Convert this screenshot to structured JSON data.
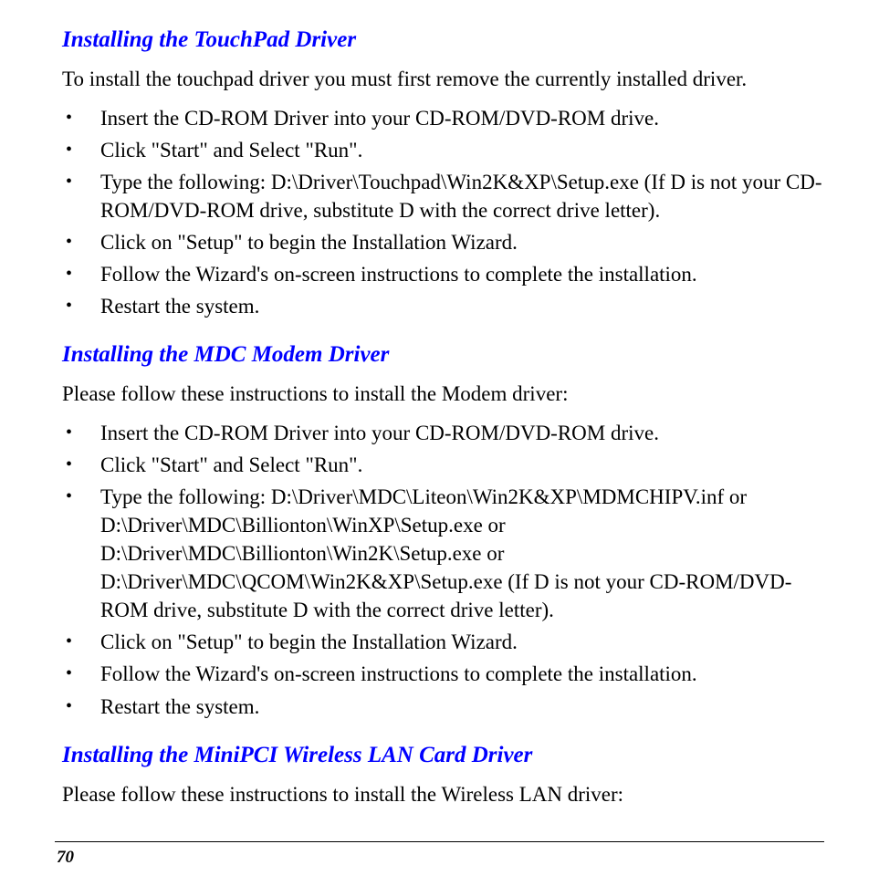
{
  "sections": [
    {
      "heading": "Installing the TouchPad Driver",
      "intro": "To install the touchpad driver you must first remove the currently installed driver.",
      "items": [
        "Insert the CD-ROM Driver into your CD-ROM/DVD-ROM drive.",
        "Click \"Start\" and Select \"Run\".",
        "Type the following: D:\\Driver\\Touchpad\\Win2K&XP\\Setup.exe (If D is not your CD-ROM/DVD-ROM drive, substitute D with the correct drive letter).",
        "Click on \"Setup\" to begin the Installation Wizard.",
        "Follow the Wizard's on-screen instructions to complete the installation.",
        "Restart the system."
      ]
    },
    {
      "heading": "Installing the MDC Modem Driver",
      "intro": "Please follow these instructions to install the Modem driver:",
      "items": [
        "Insert the CD-ROM Driver into your CD-ROM/DVD-ROM drive.",
        "Click \"Start\" and Select \"Run\".",
        "Type the following: D:\\Driver\\MDC\\Liteon\\Win2K&XP\\MDMCHIPV.inf or D:\\Driver\\MDC\\Billionton\\WinXP\\Setup.exe or D:\\Driver\\MDC\\Billionton\\Win2K\\Setup.exe or D:\\Driver\\MDC\\QCOM\\Win2K&XP\\Setup.exe (If D is not your CD-ROM/DVD-ROM drive, substitute D with the correct drive letter).",
        "Click on \"Setup\" to begin the Installation Wizard.",
        "Follow the Wizard's on-screen instructions to complete the installation.",
        "Restart the system."
      ]
    },
    {
      "heading": "Installing the MiniPCI Wireless LAN Card Driver",
      "intro": "Please follow these instructions to install the Wireless LAN driver:",
      "items": []
    }
  ],
  "page_number": "70"
}
